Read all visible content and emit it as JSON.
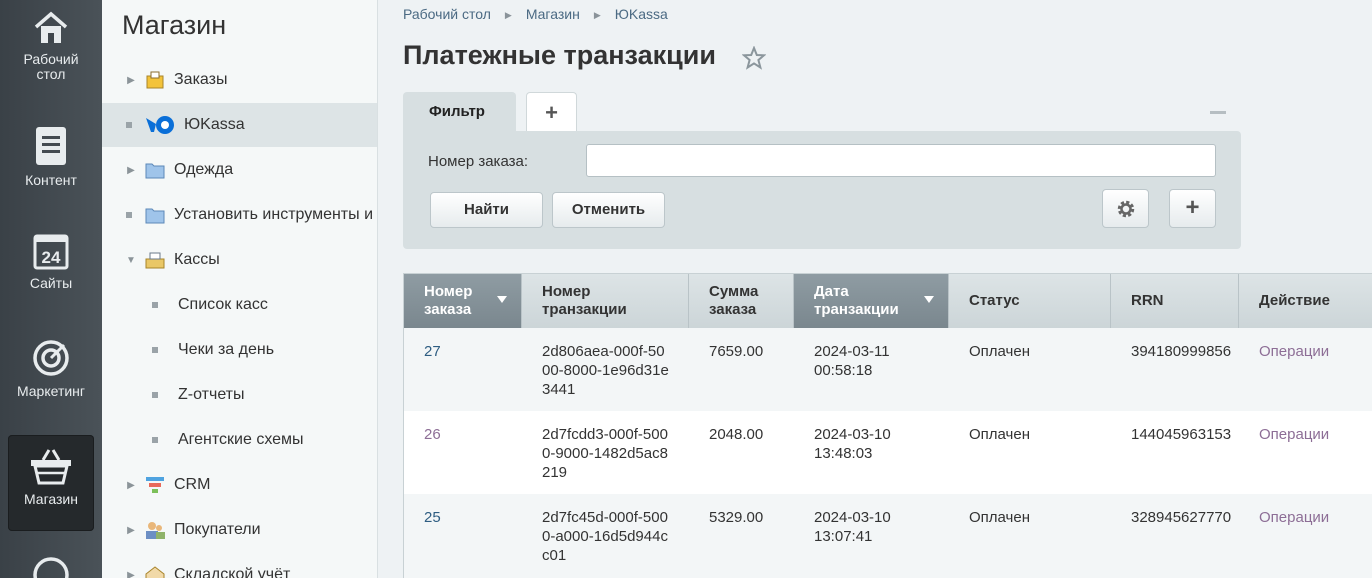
{
  "leftpanel": {
    "items": [
      {
        "label": "Рабочий стол",
        "icon": "home-icon"
      },
      {
        "label": "Контент",
        "icon": "document-icon"
      },
      {
        "label": "Сайты",
        "icon": "calendar-24-icon"
      },
      {
        "label": "Маркетинг",
        "icon": "target-icon"
      },
      {
        "label": "Магазин",
        "icon": "basket-icon"
      }
    ]
  },
  "menu": {
    "title": "Магазин",
    "items": [
      {
        "label": "Заказы",
        "icon": "orders-icon"
      },
      {
        "label": "ЮKassa",
        "icon": "yookassa-logo-icon"
      },
      {
        "label": "Одежда",
        "icon": "folder-icon"
      },
      {
        "label": "Установить инструменты и",
        "icon": "folder-icon"
      },
      {
        "label": "Кассы",
        "icon": "cash-register-icon"
      },
      {
        "label": "Список касс"
      },
      {
        "label": "Чеки за день"
      },
      {
        "label": "Z-отчеты"
      },
      {
        "label": "Агентские схемы"
      },
      {
        "label": "CRM",
        "icon": "crm-funnel-icon"
      },
      {
        "label": "Покупатели",
        "icon": "customers-icon"
      },
      {
        "label": "Складской учёт",
        "icon": "warehouse-icon"
      }
    ]
  },
  "breadcrumb": [
    "Рабочий стол",
    "Магазин",
    "ЮKassa"
  ],
  "page": {
    "title": "Платежные транзакции"
  },
  "filter": {
    "tab_label": "Фильтр",
    "add_tab": "+",
    "order_label": "Номер заказа:",
    "order_value": "",
    "find_label": "Найти",
    "cancel_label": "Отменить",
    "plus_label": "+"
  },
  "table": {
    "headers": {
      "order": "Номер заказа",
      "transaction": "Номер транзакции",
      "sum": "Сумма заказа",
      "date": "Дата транзакции",
      "status": "Статус",
      "rrn": "RRN",
      "action": "Действие"
    },
    "rows": [
      {
        "order": "27",
        "transaction": "2d806aea-000f-5000-8000-1e96d31e3441",
        "sum": "7659.00",
        "date": "2024-03-11 00:58:18",
        "status": "Оплачен",
        "rrn": "394180999856",
        "action": "Операции"
      },
      {
        "order": "26",
        "transaction": "2d7fcdd3-000f-5000-9000-1482d5ac8219",
        "sum": "2048.00",
        "date": "2024-03-10 13:48:03",
        "status": "Оплачен",
        "rrn": "144045963153",
        "action": "Операции"
      },
      {
        "order": "25",
        "transaction": "2d7fc45d-000f-5000-a000-16d5d944cc01",
        "sum": "5329.00",
        "date": "2024-03-10 13:07:41",
        "status": "Оплачен",
        "rrn": "328945627770",
        "action": "Операции"
      }
    ]
  }
}
